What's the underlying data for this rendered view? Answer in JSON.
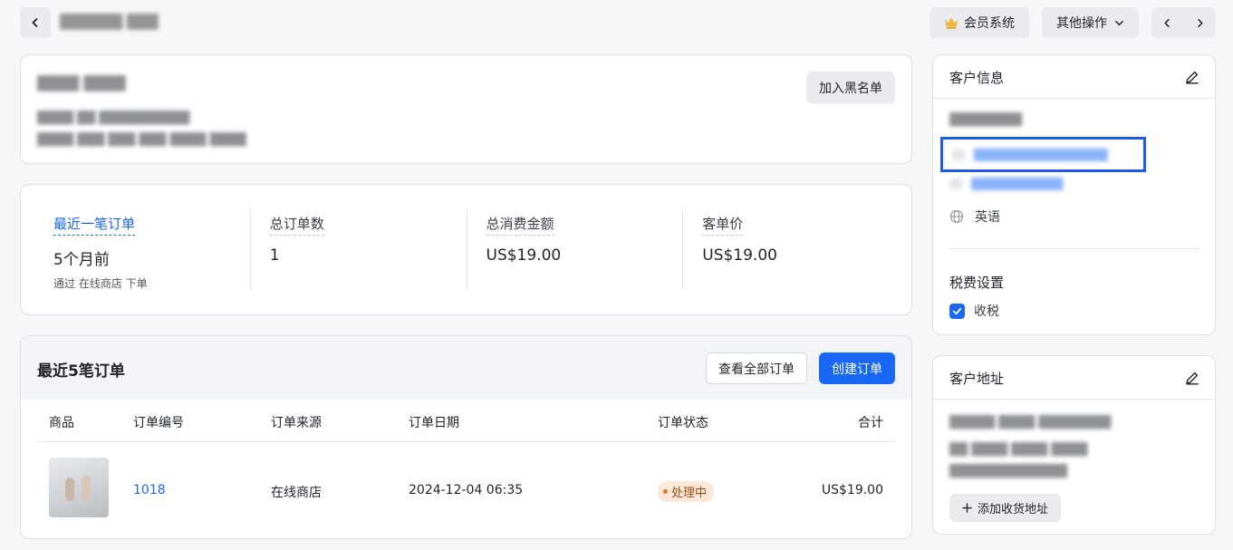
{
  "header": {
    "title": "██████ ███",
    "member_label": "会员系统",
    "more_label": "其他操作",
    "member_icon": "crown-icon"
  },
  "profile": {
    "name": "████ ████",
    "line1": "████ ██ ██████████",
    "line2": "████ ███ ███ ███ ████ ████",
    "blacklist_label": "加入黑名单"
  },
  "stats": [
    {
      "label": "最近一笔订单",
      "value": "5个月前",
      "note": "通过 在线商店 下单"
    },
    {
      "label": "总订单数",
      "value": "1",
      "note": ""
    },
    {
      "label": "总消费金额",
      "value": "US$19.00",
      "note": ""
    },
    {
      "label": "客单价",
      "value": "US$19.00",
      "note": ""
    }
  ],
  "orders": {
    "title": "最近5笔订单",
    "view_all_label": "查看全部订单",
    "create_label": "创建订单",
    "columns": [
      "商品",
      "订单编号",
      "订单来源",
      "订单日期",
      "订单状态",
      "合计"
    ],
    "rows": [
      {
        "number": "1018",
        "source": "在线商店",
        "date": "2024-12-04 06:35",
        "status": "处理中",
        "total": "US$19.00"
      }
    ]
  },
  "customer_info": {
    "title": "客户信息",
    "name": "████████",
    "email": "████████████████",
    "phone": "███████████",
    "language": "英语",
    "tax_title": "税费设置",
    "tax_label": "收税",
    "tax_checked": true
  },
  "address": {
    "title": "客户地址",
    "line1": "█████ ████ ████████",
    "line2": "██ ████ ████ ████",
    "line3": "█████████████",
    "add_label": "添加收货地址"
  },
  "colors": {
    "accent": "#1967f5",
    "status_bg": "#fde9d9",
    "highlight": "#1f5be8"
  }
}
